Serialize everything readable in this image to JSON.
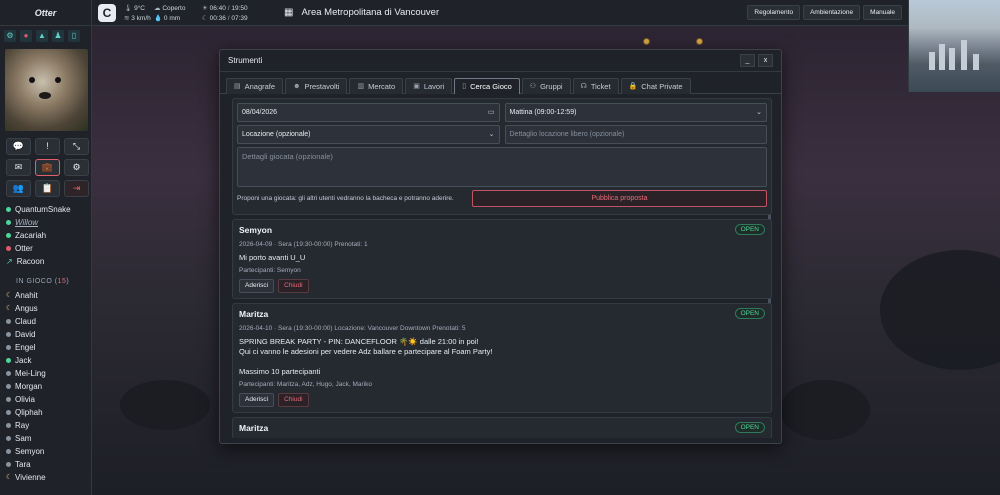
{
  "sidebar": {
    "title": "Otter",
    "quick_icons": [
      "gear-icon",
      "mic-icon",
      "building-icon",
      "person-icon",
      "phone-icon"
    ],
    "buttons": [
      {
        "icon": "chat-icon",
        "glyph": "💬"
      },
      {
        "icon": "alert-icon",
        "glyph": "!"
      },
      {
        "icon": "collapse-icon",
        "glyph": "⤡"
      },
      {
        "icon": "mail-icon",
        "glyph": "✉"
      },
      {
        "icon": "briefcase-icon",
        "glyph": "💼"
      },
      {
        "icon": "gear-icon",
        "glyph": "⚙"
      },
      {
        "icon": "group-icon",
        "glyph": "👥"
      },
      {
        "icon": "clipboard-icon",
        "glyph": "📋"
      },
      {
        "icon": "logout-icon",
        "glyph": "⇥"
      }
    ],
    "online": [
      {
        "name": "QuantumSnake",
        "status": "green"
      },
      {
        "name": "Willow",
        "status": "green",
        "italic": true
      },
      {
        "name": "Zacariah",
        "status": "green"
      },
      {
        "name": "Otter",
        "status": "red"
      },
      {
        "name": "Racoon",
        "status": "green-arrow"
      }
    ],
    "in_game_header": "IN GIOCO",
    "in_game_count": "15",
    "in_game": [
      {
        "name": "Anahit",
        "icon": "moon"
      },
      {
        "name": "Angus",
        "icon": "moon"
      },
      {
        "name": "Claud",
        "icon": "grey"
      },
      {
        "name": "David",
        "icon": "grey"
      },
      {
        "name": "Engel",
        "icon": "grey"
      },
      {
        "name": "Jack",
        "icon": "green"
      },
      {
        "name": "Mei-Ling",
        "icon": "grey"
      },
      {
        "name": "Morgan",
        "icon": "grey"
      },
      {
        "name": "Olivia",
        "icon": "grey"
      },
      {
        "name": "Qliphah",
        "icon": "grey"
      },
      {
        "name": "Ray",
        "icon": "grey"
      },
      {
        "name": "Sam",
        "icon": "grey"
      },
      {
        "name": "Semyon",
        "icon": "grey"
      },
      {
        "name": "Tara",
        "icon": "grey"
      },
      {
        "name": "Vivienne",
        "icon": "moon"
      }
    ]
  },
  "topbar": {
    "temp": "9°C",
    "sky": "Coperto",
    "sunrise": "06:40",
    "sunset": "19:50",
    "wind": "3 km/h",
    "rain": "0 mm",
    "moonrise": "00:36",
    "moonset": "07:39",
    "area": "Area Metropolitana di Vancouver",
    "buttons": [
      "Regolamento",
      "Ambientazione",
      "Manuale"
    ]
  },
  "modal": {
    "title": "Strumenti",
    "minimize": "_",
    "close": "x",
    "tabs": [
      {
        "label": "Anagrafe",
        "icon": "id-card-icon"
      },
      {
        "label": "Prestavolti",
        "icon": "masks-icon"
      },
      {
        "label": "Mercato",
        "icon": "store-icon"
      },
      {
        "label": "Lavori",
        "icon": "briefcase-icon"
      },
      {
        "label": "Cerca Gioco",
        "icon": "book-icon",
        "active": true
      },
      {
        "label": "Gruppi",
        "icon": "group-icon"
      },
      {
        "label": "Ticket",
        "icon": "headset-icon"
      },
      {
        "label": "Chat Private",
        "icon": "lock-icon"
      }
    ],
    "form": {
      "date": "08/04/2026",
      "slot": "Mattina (09:00-12:59)",
      "location": "Locazione (opzionale)",
      "location_detail_placeholder": "Dettaglio locazione libero (opzionale)",
      "details_placeholder": "Dettagli giocata (opzionale)",
      "hint": "Proponi una giocata: gli altri utenti vedranno la bacheca e potranno aderire.",
      "publish": "Pubblica proposta"
    },
    "posts": [
      {
        "author": "Semyon",
        "status": "OPEN",
        "meta": "2026-04-09 · Sera (19:30-00:00)   Prenotati: 1",
        "message": "Mi porto avanti U_U",
        "participants": "Partecipanti: Semyon",
        "join": "Aderisci",
        "close": "Chiudi"
      },
      {
        "author": "Maritza",
        "status": "OPEN",
        "meta": "2026-04-10 · Sera (19:30-00:00)   Locazione: Vancouver Downtown   Prenotati: 5",
        "message": "SPRING BREAK PARTY - PIN: DANCEFLOOR 🌴☀️ dalle 21:00 in poi!\nQui ci vanno le adesioni per vedere Adz ballare e partecipare al Foam Party!\n\nMassimo 10 partecipanti",
        "participants": "Partecipanti: Maritza, Adz, Hugo, Jack, Mariko",
        "join": "Aderisci",
        "close": "Chiudi"
      },
      {
        "author": "Maritza",
        "status": "OPEN"
      }
    ]
  }
}
